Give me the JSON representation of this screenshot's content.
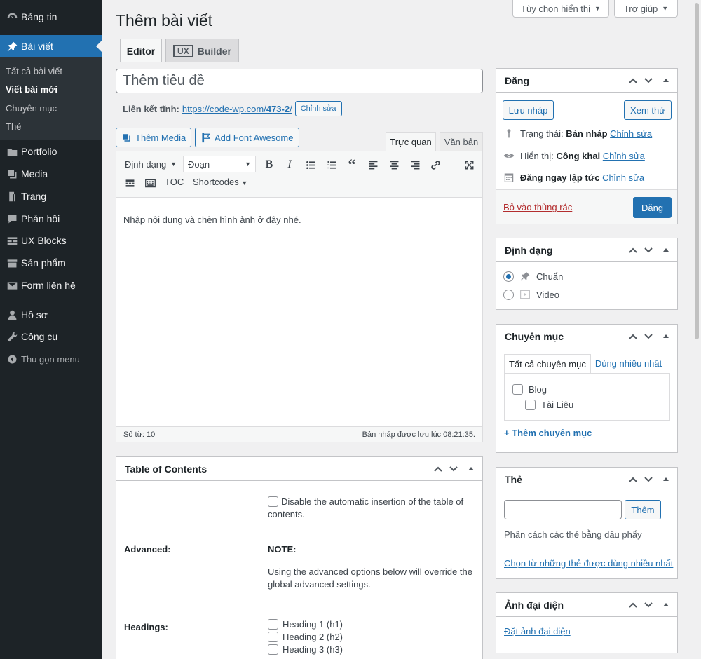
{
  "sidebar": {
    "items": [
      {
        "label": "Bảng tin",
        "icon": "dashboard-icon"
      },
      {
        "label": "Bài viết",
        "icon": "pin-icon"
      },
      {
        "label": "Portfolio",
        "icon": "folder-icon"
      },
      {
        "label": "Media",
        "icon": "media-icon"
      },
      {
        "label": "Trang",
        "icon": "page-icon"
      },
      {
        "label": "Phản hồi",
        "icon": "comment-icon"
      },
      {
        "label": "UX Blocks",
        "icon": "blocks-icon"
      },
      {
        "label": "Sản phẩm",
        "icon": "product-icon"
      },
      {
        "label": "Form liên hệ",
        "icon": "mail-icon"
      },
      {
        "label": "Hồ sơ",
        "icon": "user-icon"
      },
      {
        "label": "Công cụ",
        "icon": "wrench-icon"
      },
      {
        "label": "Thu gọn menu",
        "icon": "collapse-icon"
      }
    ],
    "submenu": [
      "Tất cả bài viết",
      "Viết bài mới",
      "Chuyên mục",
      "Thẻ"
    ]
  },
  "screen_options": {
    "label": "Tùy chọn hiển thị",
    "help": "Trợ giúp"
  },
  "page_title": "Thêm bài viết",
  "tabs": {
    "editor": "Editor",
    "ux_badge": "UX",
    "builder": "Builder"
  },
  "title_placeholder": "Thêm tiêu đề",
  "permalink": {
    "label": "Liên kết tĩnh:",
    "url_prefix": "https://code-wp.com/",
    "url_slug": "473-2",
    "url_suffix": "/",
    "edit": "Chỉnh sửa"
  },
  "media_buttons": {
    "add_media": "Thêm Media",
    "add_font_awesome": "Add Font Awesome"
  },
  "editor_modes": {
    "visual": "Trực quan",
    "text": "Văn bản"
  },
  "toolbar": {
    "format": "Định dạng",
    "paragraph": "Đoạn",
    "toc": "TOC",
    "shortcodes": "Shortcodes"
  },
  "editor": {
    "content": "Nhập nội dung và chèn hình ảnh ở đây nhé.",
    "word_count": "Số từ: 10",
    "draft_saved": "Bản nháp được lưu lúc 08:21:35."
  },
  "toc": {
    "title": "Table of Contents",
    "disable_label": "Disable the automatic insertion of the table of contents.",
    "advanced_label": "Advanced:",
    "note_label": "NOTE:",
    "note_text": "Using the advanced options below will override the global advanced settings.",
    "headings_label": "Headings:",
    "headings": [
      "Heading 1 (h1)",
      "Heading 2 (h2)",
      "Heading 3 (h3)"
    ]
  },
  "publish": {
    "title": "Đăng",
    "save_draft": "Lưu nháp",
    "preview": "Xem thử",
    "status_label": "Trạng thái:",
    "status_value": "Bản nháp",
    "visibility_label": "Hiển thị:",
    "visibility_value": "Công khai",
    "schedule_value": "Đăng ngay lập tức",
    "edit": "Chỉnh sửa",
    "trash": "Bỏ vào thùng rác",
    "publish_btn": "Đăng"
  },
  "format_box": {
    "title": "Định dạng",
    "options": [
      "Chuẩn",
      "Video"
    ],
    "selected": "Chuẩn"
  },
  "category_box": {
    "title": "Chuyên mục",
    "tab_all": "Tất cả chuyên mục",
    "tab_popular": "Dùng nhiều nhất",
    "categories": [
      "Blog",
      "Tài Liệu"
    ],
    "add_new": "+ Thêm chuyên mục"
  },
  "tags_box": {
    "title": "Thẻ",
    "add_btn": "Thêm",
    "hint": "Phân cách các thẻ bằng dấu phẩy",
    "choose": "Chọn từ những thẻ được dùng nhiều nhất"
  },
  "featured_image": {
    "title": "Ảnh đại diện",
    "set": "Đặt ảnh đại diện"
  },
  "colors": {
    "sidebar_bg": "#1d2327",
    "accent": "#2271b1",
    "danger": "#b32d2e"
  }
}
